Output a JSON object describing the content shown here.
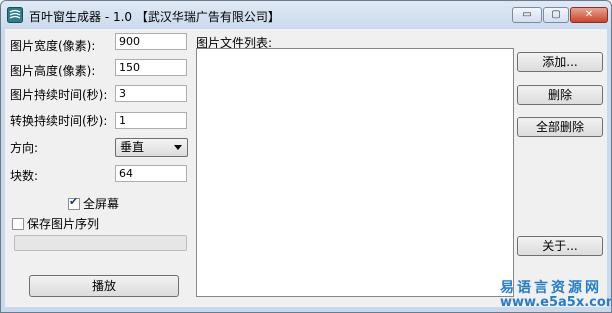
{
  "window": {
    "title": "百叶窗生成器 - 1.0 【武汉华瑞广告有限公司】",
    "minimize_label": "▭",
    "maximize_label": "▢",
    "close_label": "✕"
  },
  "form": {
    "width_label": "图片宽度(像素):",
    "width_value": "900",
    "height_label": "图片高度(像素):",
    "height_value": "150",
    "duration_label": "图片持续时间(秒):",
    "duration_value": "3",
    "transition_label": "转换持续时间(秒):",
    "transition_value": "1",
    "direction_label": "方向:",
    "direction_value": "垂直",
    "blocks_label": "块数:",
    "blocks_value": "64",
    "fullscreen_label": "全屏幕",
    "fullscreen_checked": true,
    "save_sequence_label": "保存图片序列",
    "save_sequence_checked": false,
    "play_button": "播放"
  },
  "file_list": {
    "label": "图片文件列表:",
    "items": []
  },
  "buttons": {
    "add": "添加...",
    "delete": "删除",
    "delete_all": "全部删除",
    "about": "关于..."
  },
  "watermark": {
    "line1": "易语言资源网",
    "line2": "www.e5a5x.com"
  }
}
